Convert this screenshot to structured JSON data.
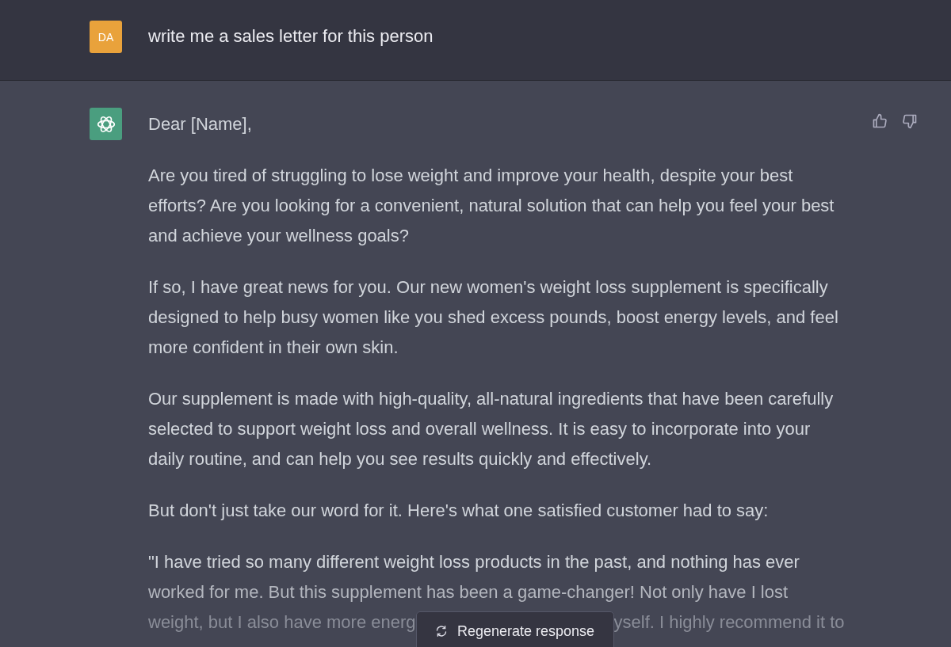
{
  "user_message": {
    "avatar_initials": "DA",
    "text": "write me a sales letter for this person"
  },
  "assistant_message": {
    "feedback": [
      {
        "kind": "thumbs_up"
      },
      {
        "kind": "thumbs_down"
      }
    ],
    "paragraphs": [
      "Dear [Name],",
      "Are you tired of struggling to lose weight and improve your health, despite your best efforts? Are you looking for a convenient, natural solution that can help you feel your best and achieve your wellness goals?",
      "If so, I have great news for you. Our new women's weight loss supplement is specifically designed to help busy women like you shed excess pounds, boost energy levels, and feel more confident in their own skin.",
      "Our supplement is made with high-quality, all-natural ingredients that have been carefully selected to support weight loss and overall wellness. It is easy to incorporate into your daily routine, and can help you see results quickly and effectively.",
      "But don't just take our word for it. Here's what one satisfied customer had to say:"
    ],
    "quote_lines": [
      "\"I have tried so many different weight loss products in the past, and nothing has ever",
      "worked for me. But this supplement has been a game-changer! Not only have I lost"
    ],
    "quote_last_line_left": "weight, but I also have more energ",
    "quote_last_line_right": "yself. I highly recommend it to"
  },
  "regenerate_button": {
    "label": "Regenerate response"
  }
}
